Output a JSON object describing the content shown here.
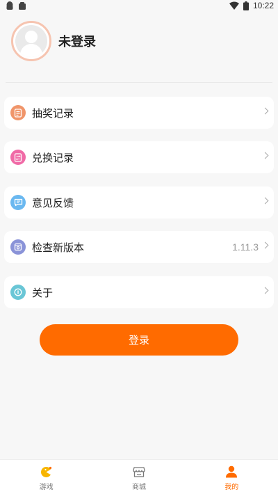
{
  "status_bar": {
    "time": "10:22"
  },
  "profile": {
    "name": "未登录"
  },
  "menu": {
    "items": [
      {
        "label": "抽奖记录",
        "icon": "lottery-record-icon",
        "color": "#f0956a",
        "value": ""
      },
      {
        "label": "兑换记录",
        "icon": "exchange-record-icon",
        "color": "#f06aa6",
        "value": ""
      },
      {
        "label": "意见反馈",
        "icon": "feedback-icon",
        "color": "#6ab8f0",
        "value": ""
      },
      {
        "label": "检查新版本",
        "icon": "version-check-icon",
        "color": "#8a93d8",
        "value": "1.11.3"
      },
      {
        "label": "关于",
        "icon": "about-icon",
        "color": "#6ac6d6",
        "value": ""
      }
    ]
  },
  "login_button": {
    "label": "登录"
  },
  "tabbar": {
    "tabs": [
      {
        "label": "游戏",
        "icon": "game-icon",
        "active": false
      },
      {
        "label": "商城",
        "icon": "store-icon",
        "active": false
      },
      {
        "label": "我的",
        "icon": "profile-icon",
        "active": true
      }
    ]
  },
  "colors": {
    "accent": "#ff6b00",
    "avatar_ring": "#f6c4b0"
  }
}
